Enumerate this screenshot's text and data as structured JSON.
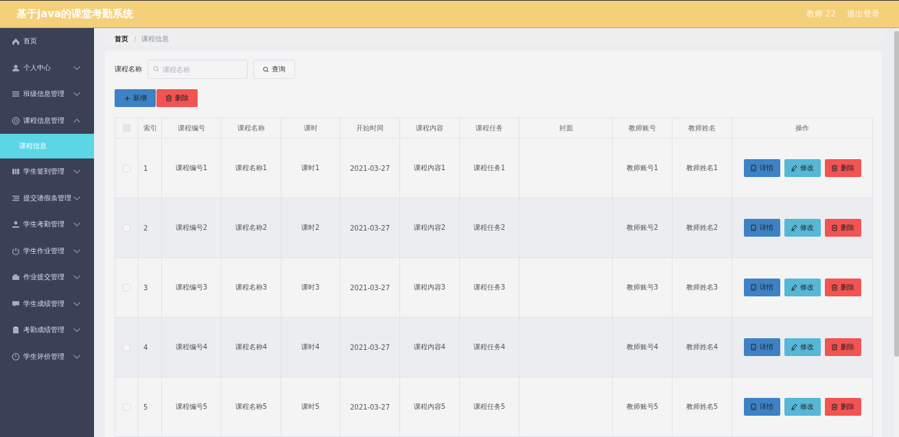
{
  "header": {
    "title": "基于java的课堂考勤系统",
    "user": "教师 22",
    "logout": "退出登录"
  },
  "sidebar": {
    "items": [
      {
        "label": "首页",
        "kind": "link"
      },
      {
        "label": "个人中心",
        "kind": "submenu",
        "expanded": false
      },
      {
        "label": "班级信息管理",
        "kind": "submenu",
        "expanded": false
      },
      {
        "label": "课程信息管理",
        "kind": "submenu",
        "expanded": true,
        "children": [
          {
            "label": "课程信息",
            "selected": true
          }
        ]
      },
      {
        "label": "学生签到管理",
        "kind": "submenu",
        "expanded": false
      },
      {
        "label": "提交请假条管理",
        "kind": "submenu",
        "expanded": false
      },
      {
        "label": "学生考勤管理",
        "kind": "submenu",
        "expanded": false
      },
      {
        "label": "学生作业管理",
        "kind": "submenu",
        "expanded": false
      },
      {
        "label": "作业提交管理",
        "kind": "submenu",
        "expanded": false
      },
      {
        "label": "学生成绩管理",
        "kind": "submenu",
        "expanded": false
      },
      {
        "label": "考勤成绩管理",
        "kind": "submenu",
        "expanded": false
      },
      {
        "label": "学生评价管理",
        "kind": "submenu",
        "expanded": false
      }
    ]
  },
  "breadcrumb": [
    "首页",
    "/",
    "课程信息"
  ],
  "search": {
    "label": "课程名称",
    "placeholder": "课程名称",
    "button": "查询"
  },
  "toolbar": {
    "add": "新增",
    "delete": "删除"
  },
  "table": {
    "columns": [
      "索引",
      "课程编号",
      "课程名称",
      "课时",
      "开始时间",
      "课程内容",
      "课程任务",
      "封面",
      "教师账号",
      "教师姓名",
      "操作"
    ],
    "header_checked": false,
    "rows": [
      {
        "checked": false,
        "cells": [
          "1",
          "课程编号1",
          "课程名称1",
          "课时1",
          "2021-03-27",
          "课程内容1",
          "课程任务1",
          "",
          "教师账号1",
          "教师姓名1"
        ],
        "actions": [
          "详情",
          "修改",
          "删除"
        ]
      },
      {
        "checked": false,
        "cells": [
          "2",
          "课程编号2",
          "课程名称2",
          "课时2",
          "2021-03-27",
          "课程内容2",
          "课程任务2",
          "",
          "教师账号2",
          "教师姓名2"
        ],
        "actions": [
          "详情",
          "修改",
          "删除"
        ]
      },
      {
        "checked": false,
        "cells": [
          "3",
          "课程编号3",
          "课程名称3",
          "课时3",
          "2021-03-27",
          "课程内容3",
          "课程任务3",
          "",
          "教师账号3",
          "教师姓名3"
        ],
        "actions": [
          "详情",
          "修改",
          "删除"
        ]
      },
      {
        "checked": false,
        "cells": [
          "4",
          "课程编号4",
          "课程名称4",
          "课时4",
          "2021-03-27",
          "课程内容4",
          "课程任务4",
          "",
          "教师账号4",
          "教师姓名4"
        ],
        "actions": [
          "详情",
          "修改",
          "删除"
        ]
      },
      {
        "checked": false,
        "cells": [
          "5",
          "课程编号5",
          "课程名称5",
          "课时5",
          "2021-03-27",
          "课程内容5",
          "课程任务5",
          "",
          "教师账号5",
          "教师姓名5"
        ],
        "actions": [
          "详情",
          "修改",
          "删除"
        ]
      }
    ]
  }
}
